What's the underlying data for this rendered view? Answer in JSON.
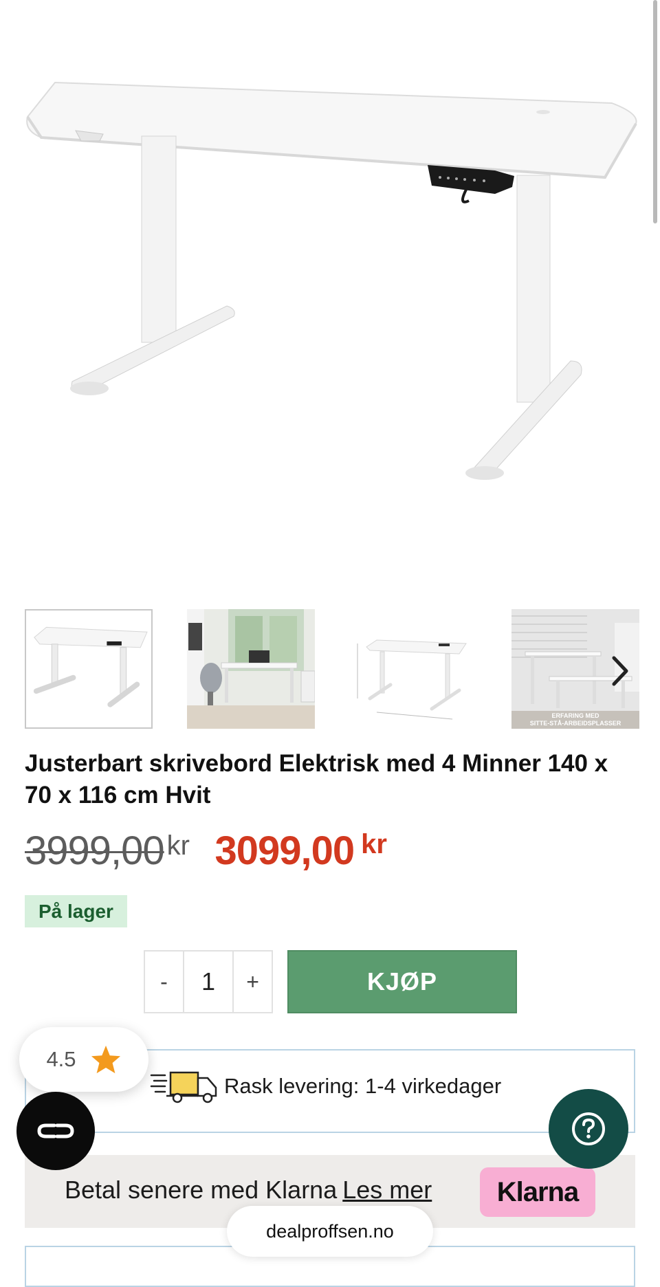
{
  "gallery": {
    "main_image_alt": "Hvitt elektrisk hev-senk skrivebord",
    "thumb_overlay_line1": "ERFARING MED",
    "thumb_overlay_line2": "SITTE-STÅ-ARBEIDSPLASSER",
    "next_icon": "chevron-right-icon"
  },
  "product": {
    "title": "Justerbart skrivebord Elektrisk med 4 Minner 140 x 70 x 116 cm Hvit",
    "old_price": "3999,00",
    "old_currency": "kr",
    "price": "3099,00",
    "currency": "kr",
    "stock_status": "På lager"
  },
  "purchase": {
    "decrement_label": "-",
    "quantity": "1",
    "increment_label": "+",
    "buy_label": "KJØP"
  },
  "delivery": {
    "icon": "delivery-truck-icon",
    "text": "Rask levering: 1-4 virkedager"
  },
  "klarna": {
    "text": "Betal senere med Klarna",
    "link": "Les mer",
    "badge": "Klarna"
  },
  "rating": {
    "value": "4.5",
    "icon": "star-icon"
  },
  "floating": {
    "cookie_icon": "cookie-settings-icon",
    "help_icon": "help-icon"
  },
  "browser": {
    "url": "dealproffsen.no"
  },
  "colors": {
    "price_red": "#d2391f",
    "buy_green": "#5b9c6f",
    "stock_bg": "#d7f0dd",
    "klarna_pink": "#f8aed3",
    "help_teal": "#134c46"
  }
}
